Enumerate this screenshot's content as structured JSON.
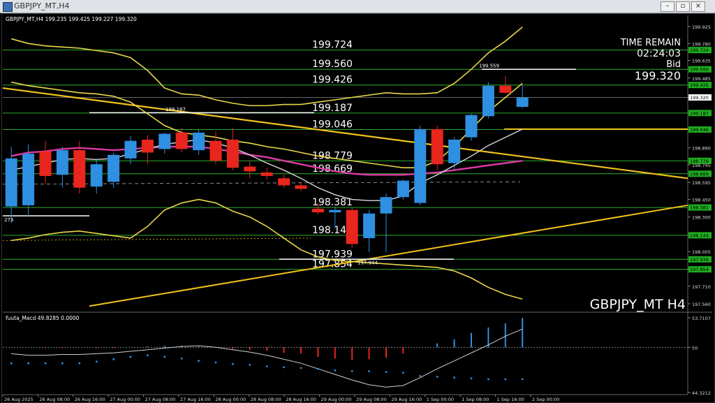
{
  "window": {
    "title": "GBPJPY_MT,H4"
  },
  "window_controls": {
    "minimize": "–",
    "restore": "▫",
    "close": "×"
  },
  "colors": {
    "bull": "#2f8fe0",
    "bear": "#e8261e",
    "level_line": "#2eae2e",
    "trend": "#f2c31b",
    "bands": "#e8d84a",
    "ma_pink": "#dc3aa6",
    "ma_white": "#d8d8d8",
    "label_bg": "#1fae1f"
  },
  "chart_data": [
    {
      "type": "candlestick",
      "symbol_info": "GBPJPY_MT,H4  199.235 199.425 199.227 199.320",
      "watermark": "GBPJPY_MT  H4",
      "info_panel": {
        "title": "TIME REMAIN",
        "time": "02:24:03",
        "bid_label": "Bid",
        "bid_value": "199.320"
      },
      "ylim": [
        197.5,
        200.02
      ],
      "y_ticks": [
        "199.925",
        "199.780",
        "199.635",
        "199.485",
        "199.320",
        "199.187",
        "199.046",
        "198.890",
        "198.745",
        "198.595",
        "198.450",
        "198.300",
        "198.155",
        "198.005",
        "197.855",
        "197.710",
        "197.560"
      ],
      "x_ticks": [
        "26 Aug 2025",
        "26 Aug 08:00",
        "26 Aug 16:00",
        "27 Aug 00:00",
        "27 Aug 08:00",
        "27 Aug 16:00",
        "28 Aug 00:00",
        "28 Aug 08:00",
        "28 Aug 16:00",
        "29 Aug 00:00",
        "29 Aug 08:00",
        "29 Aug 16:00",
        "1 Sep 00:00",
        "1 Sep 08:00",
        "1 Sep 16:00",
        "2 Sep 00:00"
      ],
      "levels": [
        {
          "value": 199.724,
          "label": "199.724"
        },
        {
          "value": 199.56,
          "label": "199.560"
        },
        {
          "value": 199.426,
          "label": "199.426"
        },
        {
          "value": 199.187,
          "label": "199.187"
        },
        {
          "value": 199.046,
          "label": "199.046"
        },
        {
          "value": 198.779,
          "label": "198.779"
        },
        {
          "value": 198.669,
          "label": "198.669"
        },
        {
          "value": 198.381,
          "label": "198.381"
        },
        {
          "value": 198.144,
          "label": "198.144"
        },
        {
          "value": 197.939,
          "label": "197.939"
        },
        {
          "value": 197.854,
          "label": "197.854"
        }
      ],
      "annotations": [
        {
          "text": "199.187",
          "value": 199.187
        },
        {
          "text": "199.559",
          "value": 199.559
        },
        {
          "text": "197.944",
          "value": 197.944
        },
        {
          "text": "273",
          "value": 198.31
        }
      ],
      "candles": [
        {
          "o": 198.39,
          "h": 198.9,
          "l": 198.25,
          "c": 198.8
        },
        {
          "o": 198.4,
          "h": 198.92,
          "l": 198.3,
          "c": 198.84
        },
        {
          "o": 198.86,
          "h": 198.95,
          "l": 198.58,
          "c": 198.65
        },
        {
          "o": 198.66,
          "h": 198.9,
          "l": 198.55,
          "c": 198.87
        },
        {
          "o": 198.87,
          "h": 198.95,
          "l": 198.5,
          "c": 198.55
        },
        {
          "o": 198.56,
          "h": 198.8,
          "l": 198.5,
          "c": 198.75
        },
        {
          "o": 198.6,
          "h": 198.85,
          "l": 198.55,
          "c": 198.83
        },
        {
          "o": 198.8,
          "h": 198.99,
          "l": 198.75,
          "c": 198.95
        },
        {
          "o": 198.96,
          "h": 199.0,
          "l": 198.75,
          "c": 198.85
        },
        {
          "o": 198.88,
          "h": 199.02,
          "l": 198.84,
          "c": 199.01
        },
        {
          "o": 199.02,
          "h": 199.06,
          "l": 198.85,
          "c": 198.88
        },
        {
          "o": 198.87,
          "h": 199.05,
          "l": 198.83,
          "c": 199.02
        },
        {
          "o": 198.95,
          "h": 199.03,
          "l": 198.75,
          "c": 198.78
        },
        {
          "o": 198.96,
          "h": 199.06,
          "l": 198.7,
          "c": 198.72
        },
        {
          "o": 198.73,
          "h": 198.78,
          "l": 198.63,
          "c": 198.69
        },
        {
          "o": 198.68,
          "h": 198.72,
          "l": 198.62,
          "c": 198.65
        },
        {
          "o": 198.63,
          "h": 198.66,
          "l": 198.55,
          "c": 198.57
        },
        {
          "o": 198.57,
          "h": 198.6,
          "l": 198.52,
          "c": 198.54
        },
        {
          "o": 198.37,
          "h": 198.42,
          "l": 198.32,
          "c": 198.34
        },
        {
          "o": 198.34,
          "h": 198.39,
          "l": 198.2,
          "c": 198.36
        },
        {
          "o": 198.36,
          "h": 198.38,
          "l": 198.04,
          "c": 198.07
        },
        {
          "o": 198.12,
          "h": 198.36,
          "l": 198.0,
          "c": 198.33
        },
        {
          "o": 198.33,
          "h": 198.5,
          "l": 198.0,
          "c": 198.47
        },
        {
          "o": 198.47,
          "h": 198.62,
          "l": 198.45,
          "c": 198.61
        },
        {
          "o": 198.42,
          "h": 199.08,
          "l": 198.4,
          "c": 199.05
        },
        {
          "o": 199.05,
          "h": 199.08,
          "l": 198.7,
          "c": 198.75
        },
        {
          "o": 198.76,
          "h": 198.98,
          "l": 198.7,
          "c": 198.96
        },
        {
          "o": 198.98,
          "h": 199.18,
          "l": 198.95,
          "c": 199.17
        },
        {
          "o": 199.16,
          "h": 199.45,
          "l": 199.14,
          "c": 199.42
        },
        {
          "o": 199.42,
          "h": 199.5,
          "l": 199.35,
          "c": 199.36
        },
        {
          "o": 199.24,
          "h": 199.43,
          "l": 199.23,
          "c": 199.32
        }
      ],
      "ma_pink": [
        198.82,
        198.85,
        198.86,
        198.88,
        198.89,
        198.88,
        198.87,
        198.88,
        198.89,
        198.9,
        198.9,
        198.9,
        198.88,
        198.86,
        198.83,
        198.81,
        198.78,
        198.75,
        198.72,
        198.69,
        198.67,
        198.66,
        198.66,
        198.66,
        198.67,
        198.68,
        198.7,
        198.72,
        198.74,
        198.76,
        198.78
      ],
      "ma_white": [
        198.7,
        198.73,
        198.76,
        198.79,
        198.8,
        198.79,
        198.8,
        198.84,
        198.88,
        198.92,
        198.94,
        198.96,
        198.93,
        198.89,
        198.83,
        198.76,
        198.7,
        198.63,
        198.55,
        198.49,
        198.45,
        198.44,
        198.44,
        198.48,
        198.59,
        198.66,
        198.74,
        198.82,
        198.91,
        198.98,
        199.05
      ],
      "upper_band": [
        199.82,
        199.78,
        199.76,
        199.75,
        199.74,
        199.72,
        199.7,
        199.66,
        199.55,
        199.4,
        199.35,
        199.34,
        199.3,
        199.27,
        199.25,
        199.25,
        199.26,
        199.26,
        199.28,
        199.3,
        199.32,
        199.34,
        199.36,
        199.35,
        199.35,
        199.36,
        199.44,
        199.56,
        199.7,
        199.8,
        199.92
      ],
      "mid_band": [
        199.45,
        199.42,
        199.4,
        199.38,
        199.36,
        199.35,
        199.33,
        199.28,
        199.18,
        199.08,
        199.02,
        199.0,
        198.98,
        198.95,
        198.93,
        198.9,
        198.88,
        198.85,
        198.82,
        198.8,
        198.78,
        198.76,
        198.74,
        198.72,
        198.72,
        198.78,
        198.9,
        199.05,
        199.2,
        199.32,
        199.44
      ],
      "lower_band": [
        198.1,
        198.12,
        198.15,
        198.17,
        198.18,
        198.16,
        198.14,
        198.12,
        198.22,
        198.36,
        198.42,
        198.45,
        198.42,
        198.35,
        198.3,
        198.22,
        198.12,
        198.02,
        197.96,
        197.93,
        197.92,
        197.91,
        197.9,
        197.89,
        197.88,
        197.87,
        197.84,
        197.78,
        197.7,
        197.64,
        197.6
      ]
    },
    {
      "type": "bar",
      "title": "fuuta_Macd 49.8285  0.0000",
      "y_ticks": [
        "53.7107",
        "50",
        "44.3212"
      ],
      "ylim": [
        44.32,
        53.71
      ],
      "values": [
        50.0,
        50.0,
        49.9,
        49.9,
        50.0,
        49.9,
        49.9,
        50.0,
        50.1,
        50.2,
        50.2,
        50.1,
        50.0,
        49.8,
        49.7,
        49.6,
        49.3,
        49.2,
        48.8,
        48.6,
        48.4,
        48.5,
        48.7,
        49.2,
        50.0,
        50.5,
        51.0,
        51.8,
        52.5,
        53.0,
        53.7
      ],
      "signal": [
        49.2,
        49.0,
        49.0,
        49.1,
        49.1,
        49.2,
        49.3,
        49.5,
        49.7,
        49.9,
        50.1,
        50.2,
        50.0,
        49.7,
        49.4,
        49.0,
        48.5,
        48.0,
        47.3,
        46.6,
        45.9,
        45.3,
        45.0,
        45.2,
        46.2,
        47.3,
        48.3,
        49.3,
        50.3,
        51.4,
        52.3
      ],
      "dots": [
        48.0,
        48.0,
        48.0,
        48.0,
        48.0,
        48.2,
        48.5,
        48.8,
        49.0,
        48.8,
        48.6,
        48.3,
        48.1,
        47.9,
        47.8,
        47.6,
        47.5,
        47.4,
        47.3,
        47.1,
        47.0,
        47.0,
        46.9,
        46.8,
        46.4,
        46.3,
        46.2,
        46.1,
        46.0,
        46.0,
        46.0
      ]
    }
  ]
}
